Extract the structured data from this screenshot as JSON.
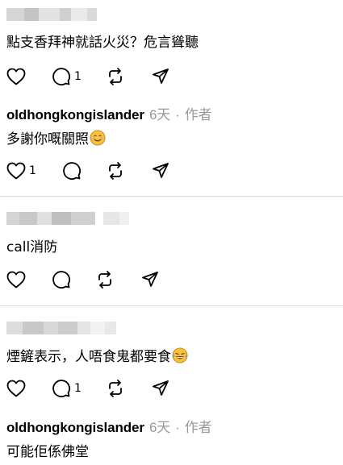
{
  "comments": [
    {
      "user": "",
      "username_blurred": true,
      "text": "點支香拜神就話火災？危言聳聽",
      "likes": "",
      "replies": "1"
    },
    {
      "user": "oldhongkongislander",
      "time": "6天",
      "sep": "·",
      "role": "作者",
      "text": "多謝你嘅關照",
      "emoji": "smiling-face-icon",
      "likes": "1",
      "replies": ""
    },
    {
      "user": "",
      "username_blurred": true,
      "text": "call消防",
      "likes": "",
      "replies": ""
    },
    {
      "user": "",
      "username_blurred": true,
      "text": "煙鏟表示，人唔食鬼都要食",
      "emoji": "laughing-tears-icon",
      "likes": "",
      "replies": "1"
    },
    {
      "user": "oldhongkongislander",
      "time": "6天",
      "sep": "·",
      "role": "作者",
      "text": "可能佢係佛堂"
    }
  ],
  "icons": [
    "heart-icon",
    "comment-icon",
    "repost-icon",
    "share-icon"
  ],
  "colors": {
    "meta": "#999999",
    "divider": "#dbdbdb",
    "emoji": "#f7c23c"
  }
}
